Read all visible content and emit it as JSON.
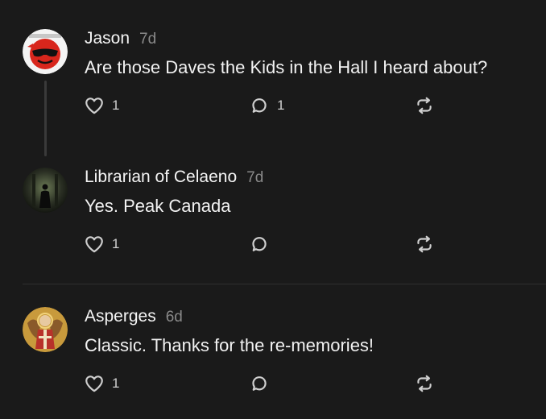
{
  "posts": [
    {
      "author": "Jason",
      "time": "7d",
      "text": "Are those Daves the Kids in the Hall I heard about?",
      "likes": "1",
      "replies": "1",
      "avatar_icon": "red-sunglasses-face-icon"
    },
    {
      "author": "Librarian of Celaeno",
      "time": "7d",
      "text": "Yes. Peak Canada",
      "likes": "1",
      "replies": "",
      "avatar_icon": "dark-figure-icon"
    },
    {
      "author": "Asperges",
      "time": "6d",
      "text": "Classic. Thanks for the re-memories!",
      "likes": "1",
      "replies": "",
      "avatar_icon": "winged-icon-icon"
    }
  ],
  "colors": {
    "background": "#1a1a1a",
    "text": "#f2f2f2",
    "muted": "#8a8a8a",
    "icon": "#cfcfcf"
  }
}
